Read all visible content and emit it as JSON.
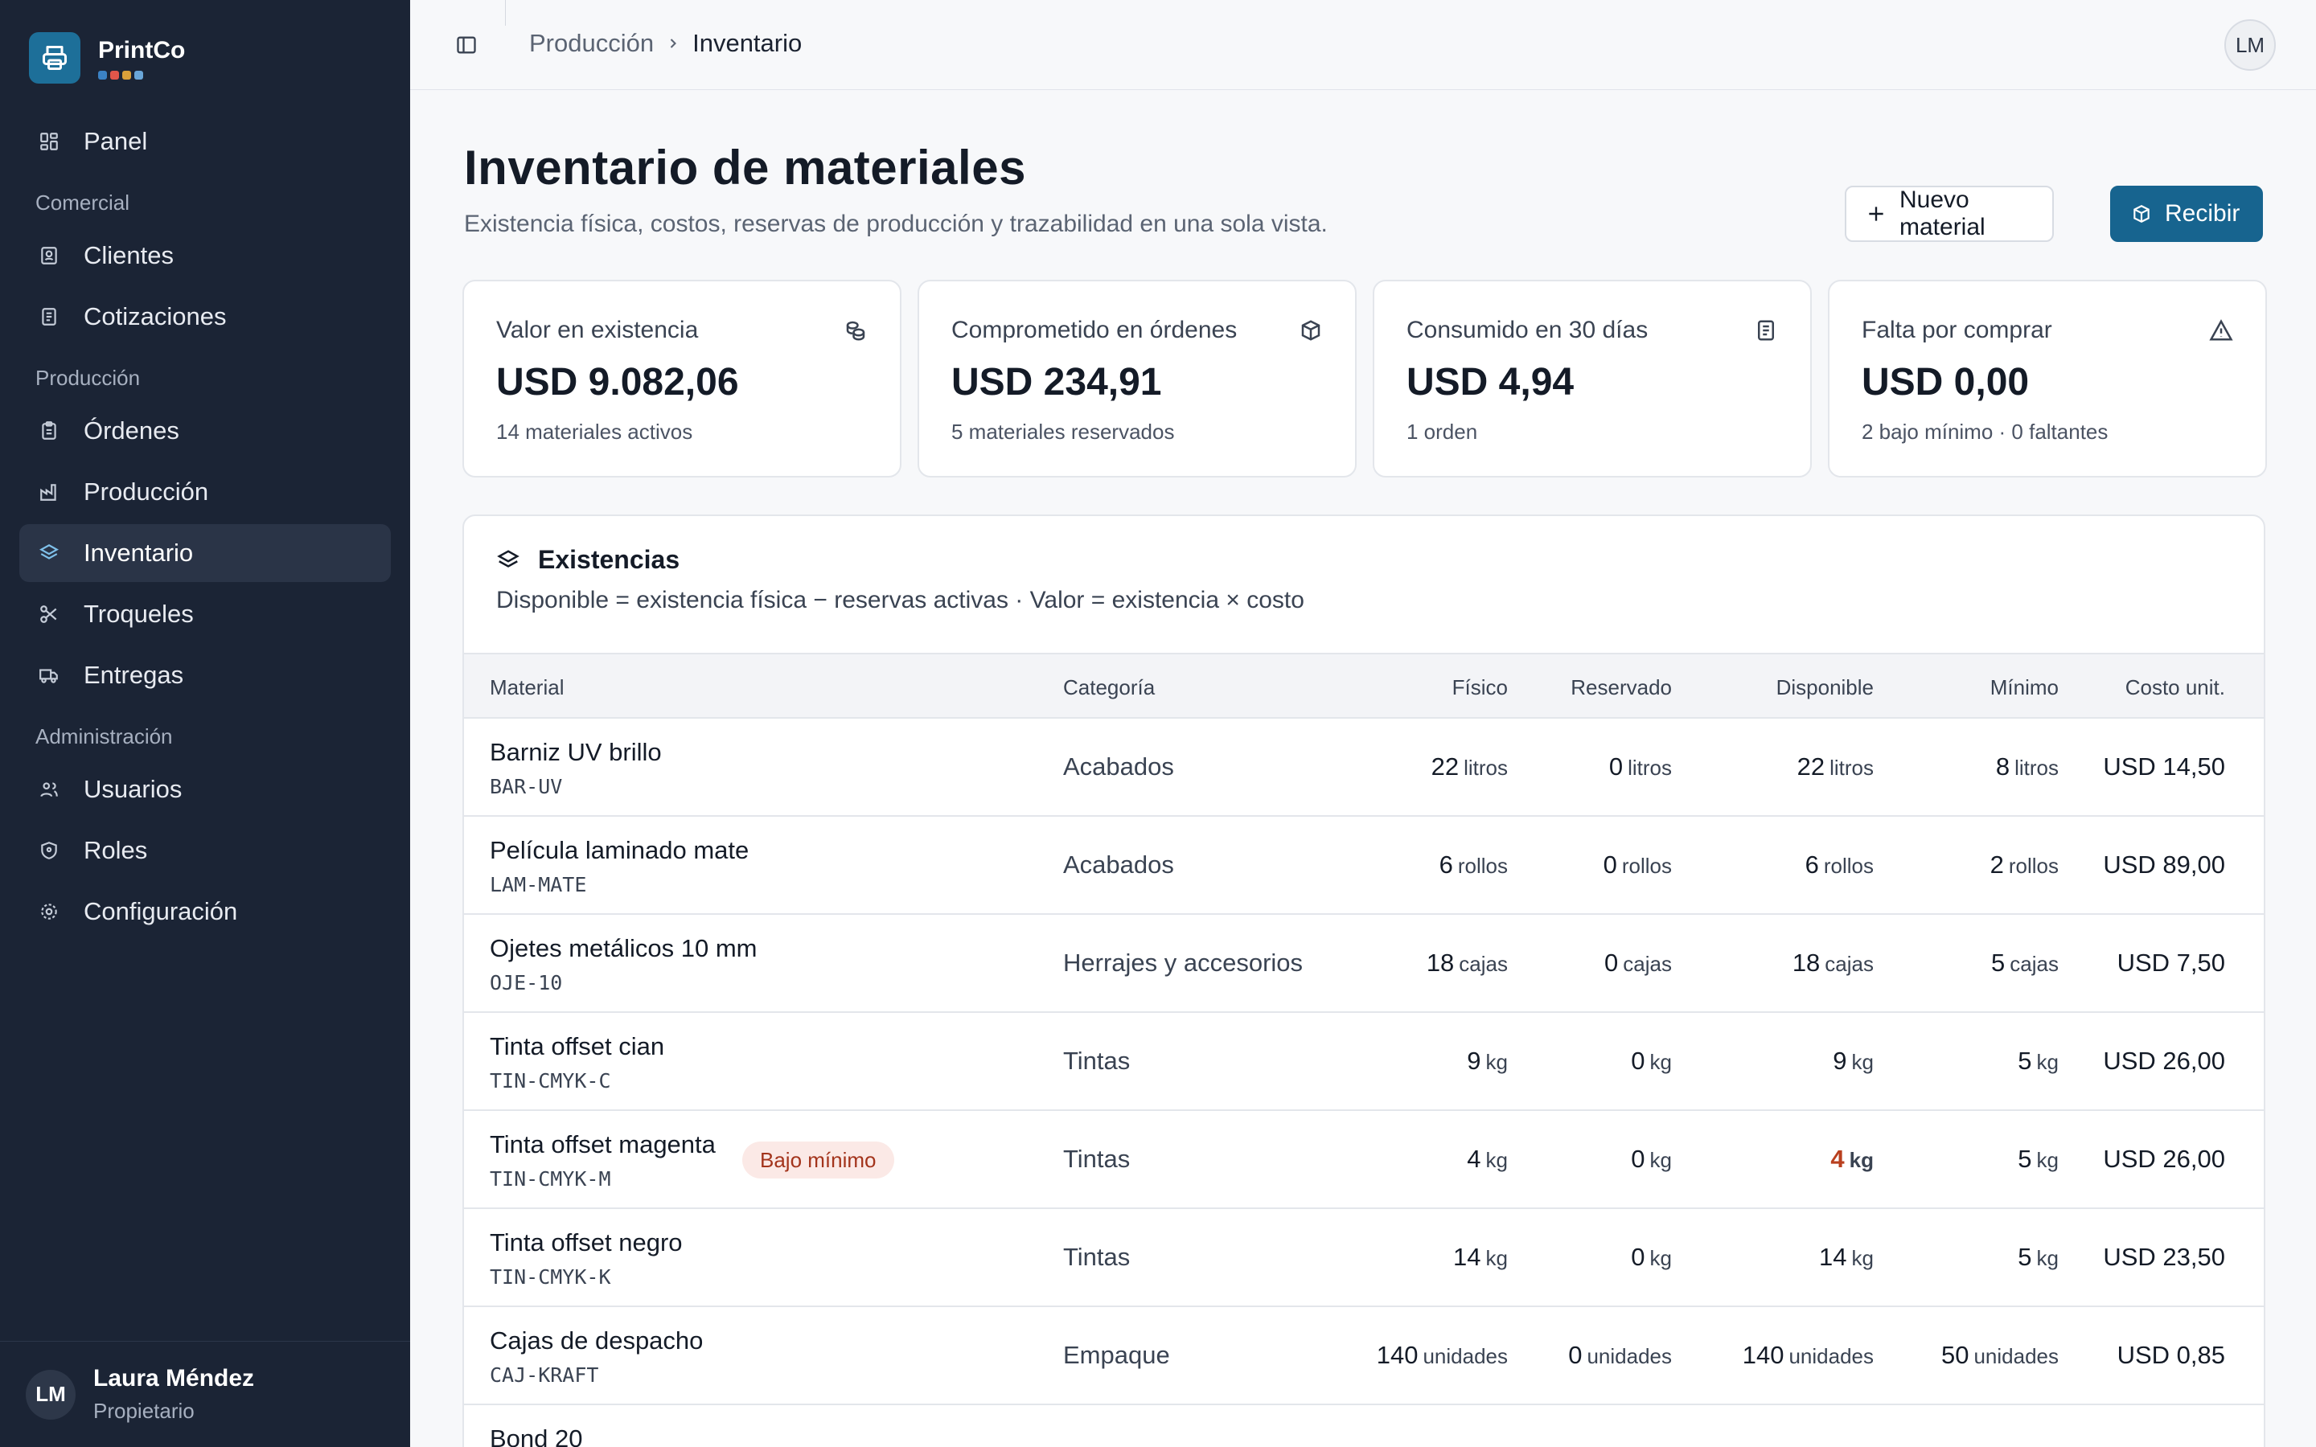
{
  "app": {
    "name": "PrintCo",
    "dot_colors": [
      "#3b82c4",
      "#e0564a",
      "#d9a03a",
      "#6aa6d8"
    ]
  },
  "sidebar": {
    "top_item": {
      "label": "Panel",
      "icon": "grid-icon"
    },
    "sections": [
      {
        "title": "Comercial",
        "items": [
          {
            "label": "Clientes",
            "icon": "contacts-icon"
          },
          {
            "label": "Cotizaciones",
            "icon": "document-icon"
          }
        ]
      },
      {
        "title": "Producción",
        "items": [
          {
            "label": "Órdenes",
            "icon": "clipboard-icon"
          },
          {
            "label": "Producción",
            "icon": "factory-icon"
          },
          {
            "label": "Inventario",
            "icon": "layers-icon",
            "active": true
          },
          {
            "label": "Troqueles",
            "icon": "scissors-icon"
          },
          {
            "label": "Entregas",
            "icon": "truck-icon"
          }
        ]
      },
      {
        "title": "Administración",
        "items": [
          {
            "label": "Usuarios",
            "icon": "users-icon"
          },
          {
            "label": "Roles",
            "icon": "shield-icon"
          },
          {
            "label": "Configuración",
            "icon": "gear-icon"
          }
        ]
      }
    ],
    "user": {
      "initials": "LM",
      "name": "Laura Méndez",
      "role": "Propietario"
    }
  },
  "topbar": {
    "breadcrumb_parent": "Producción",
    "breadcrumb_current": "Inventario",
    "avatar_initials": "LM"
  },
  "header": {
    "title": "Inventario de materiales",
    "subtitle": "Existencia física, costos, reservas de producción y trazabilidad en una sola vista.",
    "new_button": "Nuevo material",
    "receive_button": "Recibir"
  },
  "stats": [
    {
      "label": "Valor en existencia",
      "value": "USD 9.082,06",
      "meta": "14 materiales activos",
      "icon": "coins-icon"
    },
    {
      "label": "Comprometido en órdenes",
      "value": "USD 234,91",
      "meta": "5 materiales reservados",
      "icon": "box-icon"
    },
    {
      "label": "Consumido en 30 días",
      "value": "USD 4,94",
      "meta": "1 orden",
      "icon": "receipt-icon"
    },
    {
      "label": "Falta por comprar",
      "value": "USD 0,00",
      "meta": "2 bajo mínimo · 0 faltantes",
      "icon": "warning-icon"
    }
  ],
  "table": {
    "title": "Existencias",
    "description": "Disponible = existencia física − reservas activas · Valor = existencia × costo",
    "columns": {
      "material": "Material",
      "category": "Categoría",
      "physical": "Físico",
      "reserved": "Reservado",
      "available": "Disponible",
      "minimum": "Mínimo",
      "unit_cost": "Costo unit."
    },
    "rows": [
      {
        "name": "Barniz UV brillo",
        "code": "BAR-UV",
        "category": "Acabados",
        "physical": "22",
        "reserved": "0",
        "available": "22",
        "minimum": "8",
        "unit": "litros",
        "cost": "USD 14,50",
        "badge": ""
      },
      {
        "name": "Película laminado mate",
        "code": "LAM-MATE",
        "category": "Acabados",
        "physical": "6",
        "reserved": "0",
        "available": "6",
        "minimum": "2",
        "unit": "rollos",
        "cost": "USD 89,00",
        "badge": ""
      },
      {
        "name": "Ojetes metálicos 10 mm",
        "code": "OJE-10",
        "category": "Herrajes y accesorios",
        "physical": "18",
        "reserved": "0",
        "available": "18",
        "minimum": "5",
        "unit": "cajas",
        "cost": "USD 7,50",
        "badge": ""
      },
      {
        "name": "Tinta offset cian",
        "code": "TIN-CMYK-C",
        "category": "Tintas",
        "physical": "9",
        "reserved": "0",
        "available": "9",
        "minimum": "5",
        "unit": "kg",
        "cost": "USD 26,00",
        "badge": ""
      },
      {
        "name": "Tinta offset magenta",
        "code": "TIN-CMYK-M",
        "category": "Tintas",
        "physical": "4",
        "reserved": "0",
        "available": "4",
        "minimum": "5",
        "unit": "kg",
        "cost": "USD 26,00",
        "badge": "Bajo mínimo",
        "low": true
      },
      {
        "name": "Tinta offset negro",
        "code": "TIN-CMYK-K",
        "category": "Tintas",
        "physical": "14",
        "reserved": "0",
        "available": "14",
        "minimum": "5",
        "unit": "kg",
        "cost": "USD 23,50",
        "badge": ""
      },
      {
        "name": "Cajas de despacho",
        "code": "CAJ-KRAFT",
        "category": "Empaque",
        "physical": "140",
        "reserved": "0",
        "available": "140",
        "minimum": "50",
        "unit": "unidades",
        "cost": "USD 0,85",
        "badge": ""
      },
      {
        "name": "Bond 20",
        "code": "",
        "category": "",
        "physical": "",
        "reserved": "",
        "available": "",
        "minimum": "",
        "unit": "",
        "cost": "",
        "badge": ""
      }
    ]
  }
}
